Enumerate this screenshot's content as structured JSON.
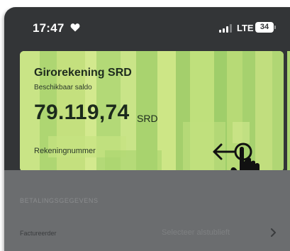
{
  "status_bar": {
    "time": "17:47",
    "network": "LTE",
    "battery": "34"
  },
  "account_card": {
    "title": "Girorekening SRD",
    "subtitle": "Beschikbaar saldo",
    "balance": "79.119,74",
    "currency": "SRD",
    "account_number_label": "Rekeningnummer",
    "color": "#b9dd78"
  },
  "form": {
    "section_header": "BETALINGSGEGEVENS",
    "rows": [
      {
        "label": "Factureerder",
        "value": "Selecteer alstublieft"
      }
    ]
  },
  "icons": {
    "status": "heart-icon",
    "swipe": "swipe-left-gesture-icon",
    "row_action": "chevron-right-icon"
  }
}
